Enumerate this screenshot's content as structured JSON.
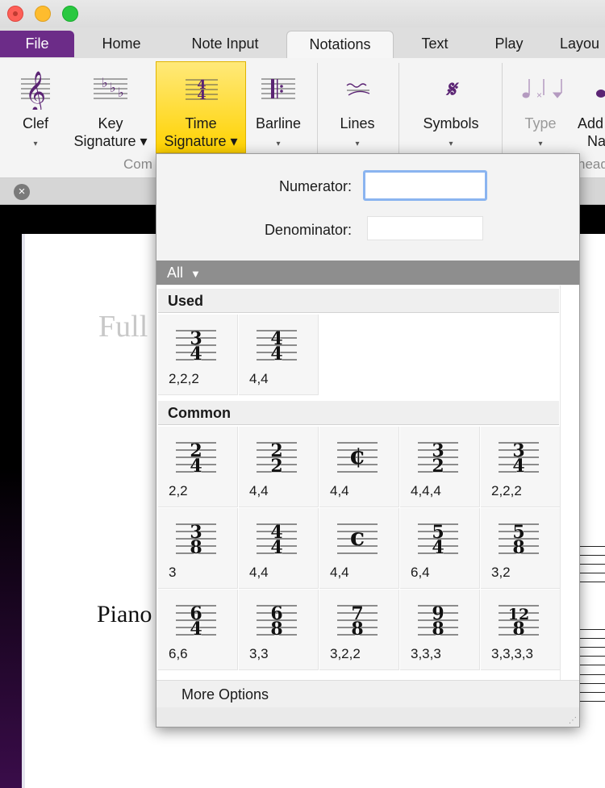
{
  "window": {
    "controls": [
      "close",
      "minimize",
      "maximize"
    ]
  },
  "tabs": [
    {
      "label": "File"
    },
    {
      "label": "Home"
    },
    {
      "label": "Note Input"
    },
    {
      "label": "Notations"
    },
    {
      "label": "Text"
    },
    {
      "label": "Play"
    },
    {
      "label": "Layou"
    }
  ],
  "ribbon": {
    "buttons": [
      {
        "line1": "Clef",
        "line2": "",
        "arrow": "▾"
      },
      {
        "line1": "Key",
        "line2": "Signature ▾",
        "arrow": ""
      },
      {
        "line1": "Time",
        "line2": "Signature ▾",
        "arrow": ""
      },
      {
        "line1": "Barline",
        "line2": "",
        "arrow": "▾"
      },
      {
        "line1": "Lines",
        "line2": "",
        "arrow": "▾"
      },
      {
        "line1": "Symbols",
        "line2": "",
        "arrow": "▾"
      },
      {
        "line1": "Type",
        "line2": "",
        "arrow": "▾"
      },
      {
        "line1": "Add",
        "line2": "Na",
        "arrow": ""
      }
    ],
    "groups": [
      {
        "label": "Com"
      },
      {
        "label": "head"
      }
    ]
  },
  "score": {
    "title": "Full",
    "instrument": "Piano"
  },
  "popup": {
    "numerator_label": "Numerator:",
    "numerator_value": "",
    "denominator_label": "Denominator:",
    "denominator_value": "",
    "filter": "All",
    "sections": [
      {
        "title": "Used",
        "items": [
          {
            "num": "3",
            "den": "4",
            "code": "2,2,2"
          },
          {
            "num": "4",
            "den": "4",
            "code": "4,4"
          }
        ]
      },
      {
        "title": "Common",
        "items": [
          {
            "num": "2",
            "den": "4",
            "code": "2,2"
          },
          {
            "num": "2",
            "den": "2",
            "code": "4,4"
          },
          {
            "num": "¢",
            "den": "",
            "code": "4,4"
          },
          {
            "num": "3",
            "den": "2",
            "code": "4,4,4"
          },
          {
            "num": "3",
            "den": "4",
            "code": "2,2,2"
          },
          {
            "num": "3",
            "den": "8",
            "code": "3"
          },
          {
            "num": "4",
            "den": "4",
            "code": "4,4"
          },
          {
            "num": "c",
            "den": "",
            "code": "4,4"
          },
          {
            "num": "5",
            "den": "4",
            "code": "6,4"
          },
          {
            "num": "5",
            "den": "8",
            "code": "3,2"
          },
          {
            "num": "6",
            "den": "4",
            "code": "6,6"
          },
          {
            "num": "6",
            "den": "8",
            "code": "3,3"
          },
          {
            "num": "7",
            "den": "8",
            "code": "3,2,2"
          },
          {
            "num": "9",
            "den": "8",
            "code": "3,3,3"
          },
          {
            "num": "12",
            "den": "8",
            "code": "3,3,3,3"
          }
        ]
      }
    ],
    "more_options": "More Options"
  }
}
